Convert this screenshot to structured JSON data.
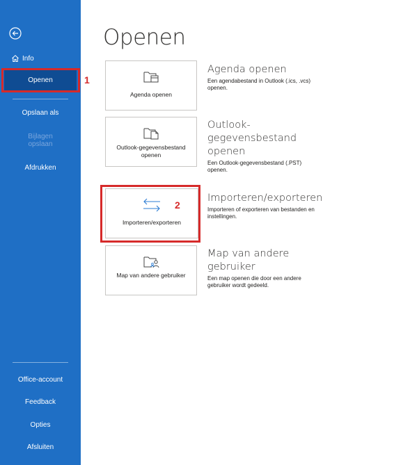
{
  "sidebar": {
    "back_icon": "back-arrow-circle-icon",
    "info": {
      "label": "Info",
      "icon": "home-icon"
    },
    "items": [
      {
        "label": "Openen",
        "selected": true
      },
      {
        "label": "Opslaan als"
      },
      {
        "label": "Bijlagen opslaan",
        "disabled": true
      },
      {
        "label": "Afdrukken"
      }
    ],
    "bottom_items": [
      {
        "label": "Office-account"
      },
      {
        "label": "Feedback"
      },
      {
        "label": "Opties"
      },
      {
        "label": "Afsluiten"
      }
    ],
    "colors": {
      "background": "#1f6fc5",
      "selected": "#0f4c93"
    }
  },
  "main": {
    "title": "Openen",
    "options": [
      {
        "tile_label": "Agenda openen",
        "icon": "calendar-folder-icon",
        "title": "Agenda openen",
        "description": "Een agendabestand in Outlook (.ics, .vcs) openen."
      },
      {
        "tile_label": "Outlook-gegevensbestand openen",
        "icon": "data-file-folder-icon",
        "title": "Outlook-gegevensbestand openen",
        "description": "Een Outlook-gegevensbestand (.PST) openen."
      },
      {
        "tile_label": "Importeren/exporteren",
        "icon": "import-export-arrows-icon",
        "title": "Importeren/exporteren",
        "description": "Importeren of exporteren van bestanden en instellingen."
      },
      {
        "tile_label": "Map van andere gebruiker",
        "icon": "shared-folder-user-icon",
        "title": "Map van andere gebruiker",
        "description": "Een map openen die door een andere gebruiker wordt gedeeld."
      }
    ]
  },
  "annotations": {
    "marker_1": "1",
    "marker_2": "2",
    "color": "#d62a2a"
  }
}
